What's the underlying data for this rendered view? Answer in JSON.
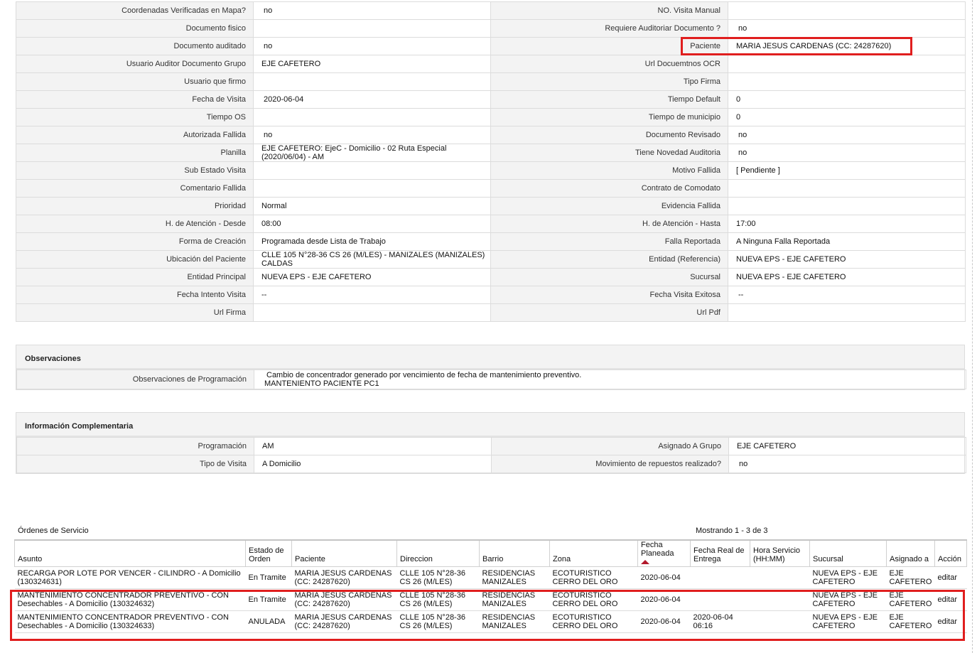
{
  "detail_rows": [
    {
      "l1": "Coordenadas Verificadas en Mapa?",
      "v1": "no",
      "l2": "NO. Visita Manual",
      "v2": ""
    },
    {
      "l1": "Documento fisico",
      "v1": "",
      "l2": "Requiere Auditoriar Documento ?",
      "v2": "no"
    },
    {
      "l1": "Documento auditado",
      "v1": "no",
      "l2": "Paciente",
      "v2": "MARIA JESUS CARDENAS (CC: 24287620)"
    },
    {
      "l1": "Usuario Auditor Documento Grupo",
      "v1": "EJE CAFETERO",
      "l2": "Url Docuemtnos OCR",
      "v2": ""
    },
    {
      "l1": "Usuario que firmo",
      "v1": "",
      "l2": "Tipo Firma",
      "v2": ""
    },
    {
      "l1": "Fecha de Visita",
      "v1": "2020-06-04",
      "l2": "Tiempo Default",
      "v2": "0"
    },
    {
      "l1": "Tiempo OS",
      "v1": "",
      "l2": "Tiempo de municipio",
      "v2": "0"
    },
    {
      "l1": "Autorizada Fallida",
      "v1": "no",
      "l2": "Documento Revisado",
      "v2": "no"
    },
    {
      "l1": "Planilla",
      "v1": "EJE CAFETERO: EjeC - Domicilio - 02 Ruta Especial (2020/06/04) - AM",
      "l2": "Tiene Novedad Auditoria",
      "v2": "no"
    },
    {
      "l1": "Sub Estado Visita",
      "v1": "",
      "l2": "Motivo Fallida",
      "v2": "[ Pendiente ]"
    },
    {
      "l1": "Comentario Fallida",
      "v1": "",
      "l2": "Contrato de Comodato",
      "v2": ""
    },
    {
      "l1": "Prioridad",
      "v1": "Normal",
      "l2": "Evidencia Fallida",
      "v2": ""
    },
    {
      "l1": "H. de Atención - Desde",
      "v1": "08:00",
      "l2": "H. de Atención - Hasta",
      "v2": "17:00"
    },
    {
      "l1": "Forma de Creación",
      "v1": "Programada desde Lista de Trabajo",
      "l2": "Falla Reportada",
      "v2": "A Ninguna Falla Reportada"
    },
    {
      "l1": "Ubicación del Paciente",
      "v1": "CLLE 105 N°28-36 CS 26 (M/LES) - MANIZALES (MANIZALES) CALDAS",
      "l2": "Entidad (Referencia)",
      "v2": "NUEVA EPS - EJE CAFETERO"
    },
    {
      "l1": "Entidad Principal",
      "v1": "NUEVA EPS - EJE CAFETERO",
      "l2": "Sucursal",
      "v2": "NUEVA EPS - EJE CAFETERO"
    },
    {
      "l1": "Fecha Intento Visita",
      "v1": "--",
      "l2": "Fecha Visita Exitosa",
      "v2": "--"
    },
    {
      "l1": "Url Firma",
      "v1": "",
      "l2": "Url Pdf",
      "v2": ""
    }
  ],
  "observaciones": {
    "title": "Observaciones",
    "label": "Observaciones de Programación",
    "line1": "Cambio de concentrador generado por vencimiento de fecha de mantenimiento preventivo.",
    "line2": "MANTENIENTO PACIENTE PC1"
  },
  "complementaria": {
    "title": "Información Complementaria",
    "rows": [
      {
        "l1": "Programación",
        "v1": "AM",
        "l2": "Asignado A Grupo",
        "v2": "EJE CAFETERO"
      },
      {
        "l1": "Tipo de Visita",
        "v1": "A Domicilio",
        "l2": "Movimiento de repuestos realizado?",
        "v2": "no"
      }
    ]
  },
  "orders": {
    "title": "Órdenes de Servicio",
    "count_text": "Mostrando 1 - 3 de 3",
    "headers": [
      "Asunto",
      "Estado de Orden",
      "Paciente",
      "Direccion",
      "Barrio",
      "Zona",
      "Fecha Planeada",
      "Fecha Real de Entrega",
      "Hora Servicio (HH:MM)",
      "Sucursal",
      "Asignado a",
      "Acción"
    ],
    "rows": [
      {
        "asunto": "RECARGA POR LOTE POR VENCER - CILINDRO - A Domicilio (130324631)",
        "estado": "En Tramite",
        "paciente": "MARIA JESUS CARDENAS (CC: 24287620)",
        "direccion": "CLLE 105 N°28-36 CS 26 (M/LES)",
        "barrio": "RESIDENCIAS MANIZALES",
        "zona": "ECOTURISTICO CERRO DEL ORO",
        "fecha_planeada": "2020-06-04",
        "fecha_real": "",
        "hora": "",
        "sucursal": "NUEVA EPS - EJE CAFETERO",
        "asignado": "EJE CAFETERO",
        "accion": "editar"
      },
      {
        "asunto": "MANTENIMIENTO CONCENTRADOR PREVENTIVO - CON Desechables - A Domicilio (130324632)",
        "estado": "En Tramite",
        "paciente": "MARIA JESUS CARDENAS (CC: 24287620)",
        "direccion": "CLLE 105 N°28-36 CS 26 (M/LES)",
        "barrio": "RESIDENCIAS MANIZALES",
        "zona": "ECOTURISTICO CERRO DEL ORO",
        "fecha_planeada": "2020-06-04",
        "fecha_real": "",
        "hora": "",
        "sucursal": "NUEVA EPS - EJE CAFETERO",
        "asignado": "EJE CAFETERO",
        "accion": "editar"
      },
      {
        "asunto": "MANTENIMIENTO CONCENTRADOR PREVENTIVO - CON Desechables - A Domicilio (130324633)",
        "estado": "ANULADA",
        "paciente": "MARIA JESUS CARDENAS (CC: 24287620)",
        "direccion": "CLLE 105 N°28-36 CS 26 (M/LES)",
        "barrio": "RESIDENCIAS MANIZALES",
        "zona": "ECOTURISTICO CERRO DEL ORO",
        "fecha_planeada": "2020-06-04",
        "fecha_real": "2020-06-04 06:16",
        "hora": "",
        "sucursal": "NUEVA EPS - EJE CAFETERO",
        "asignado": "EJE CAFETERO",
        "accion": "editar"
      }
    ]
  },
  "colors": {
    "highlight": "#e01e1e",
    "sort_indicator": "#b2182b"
  }
}
